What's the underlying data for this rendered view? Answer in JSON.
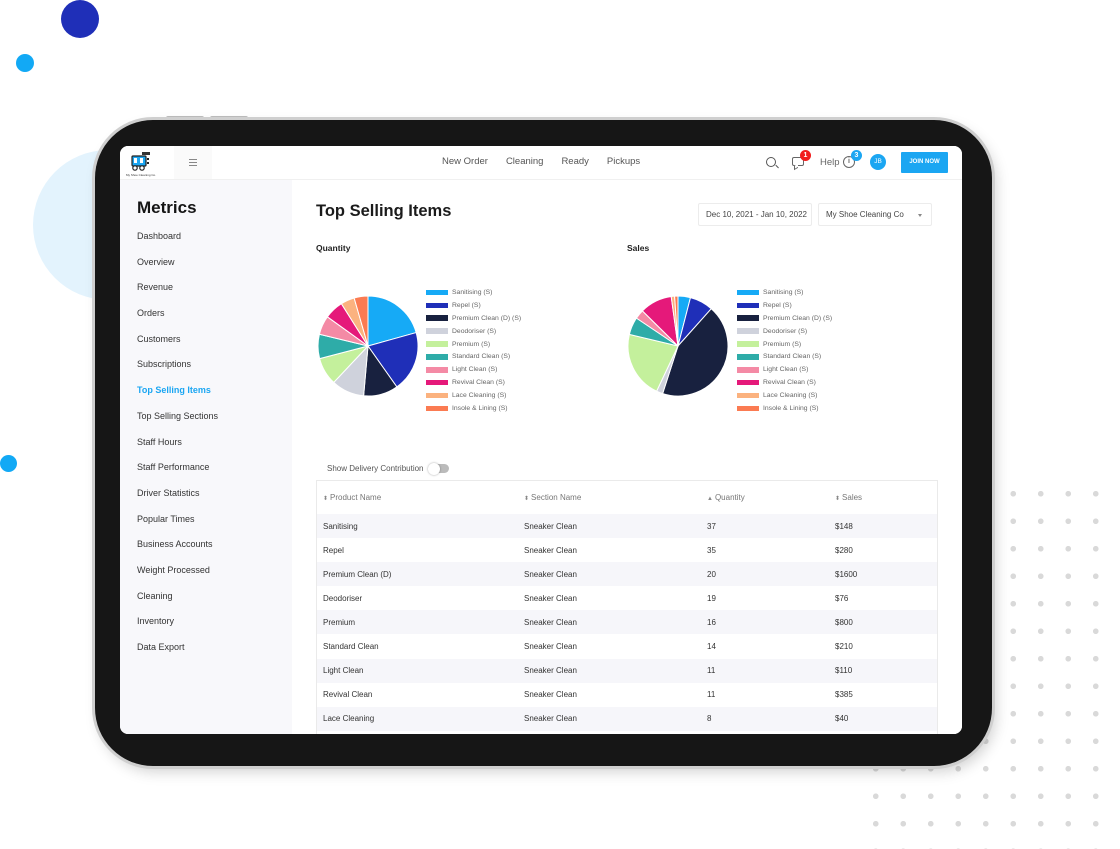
{
  "header": {
    "logo_caption": "My Shoe Cleaning Co.",
    "nav": [
      "New Order",
      "Cleaning",
      "Ready",
      "Pickups"
    ],
    "messages_badge": "1",
    "help_label": "Help",
    "help_badge": "3",
    "info_glyph": "i",
    "avatar_initials": "JB",
    "join_button": "JOIN NOW"
  },
  "sidebar": {
    "title": "Metrics",
    "items": [
      {
        "label": "Dashboard",
        "active": false
      },
      {
        "label": "Overview",
        "active": false
      },
      {
        "label": "Revenue",
        "active": false
      },
      {
        "label": "Orders",
        "active": false
      },
      {
        "label": "Customers",
        "active": false
      },
      {
        "label": "Subscriptions",
        "active": false
      },
      {
        "label": "Top Selling Items",
        "active": true
      },
      {
        "label": "Top Selling Sections",
        "active": false
      },
      {
        "label": "Staff Hours",
        "active": false
      },
      {
        "label": "Staff Performance",
        "active": false
      },
      {
        "label": "Driver Statistics",
        "active": false
      },
      {
        "label": "Popular Times",
        "active": false
      },
      {
        "label": "Business Accounts",
        "active": false
      },
      {
        "label": "Weight Processed",
        "active": false
      },
      {
        "label": "Cleaning",
        "active": false
      },
      {
        "label": "Inventory",
        "active": false
      },
      {
        "label": "Data Export",
        "active": false
      }
    ]
  },
  "main": {
    "title": "Top Selling Items",
    "date_range": "Dec 10, 2021 - Jan 10, 2022",
    "company": "My Shoe Cleaning Co",
    "delivery_toggle_label": "Show Delivery Contribution",
    "delivery_toggle_on": false
  },
  "colors": {
    "accent": "#1ba6f2",
    "badge_red": "#f11c1c"
  },
  "chart_data": [
    {
      "type": "pie",
      "title": "Quantity",
      "legend_position": "right",
      "labels": [
        "Sanitising (S)",
        "Repel (S)",
        "Premium Clean (D) (S)",
        "Deodoriser (S)",
        "Premium (S)",
        "Standard Clean (S)",
        "Light Clean (S)",
        "Revival Clean (S)",
        "Lace Cleaning (S)",
        "Insole & Lining (S)"
      ],
      "colors": [
        "#16aaf6",
        "#1f2fb8",
        "#18213f",
        "#cfd2dc",
        "#c4f09c",
        "#2eaca8",
        "#f48aa5",
        "#e5197a",
        "#fbb27f",
        "#fb7b52"
      ],
      "values": [
        37,
        35,
        20,
        19,
        16,
        14,
        11,
        11,
        8,
        8
      ]
    },
    {
      "type": "pie",
      "title": "Sales",
      "legend_position": "right",
      "labels": [
        "Sanitising (S)",
        "Repel (S)",
        "Premium Clean (D) (S)",
        "Deodoriser (S)",
        "Premium (S)",
        "Standard Clean (S)",
        "Light Clean (S)",
        "Revival Clean (S)",
        "Lace Cleaning (S)",
        "Insole & Lining (S)"
      ],
      "colors": [
        "#16aaf6",
        "#1f2fb8",
        "#18213f",
        "#cfd2dc",
        "#c4f09c",
        "#2eaca8",
        "#f48aa5",
        "#e5197a",
        "#fbb27f",
        "#fb7b52"
      ],
      "values": [
        148,
        280,
        1600,
        76,
        800,
        210,
        110,
        385,
        40,
        40
      ]
    }
  ],
  "table": {
    "columns": [
      {
        "label": "Product Name",
        "sort": "both"
      },
      {
        "label": "Section Name",
        "sort": "both"
      },
      {
        "label": "Quantity",
        "sort": "up"
      },
      {
        "label": "Sales",
        "sort": "both"
      }
    ],
    "rows": [
      [
        "Sanitising",
        "Sneaker Clean",
        "37",
        "$148"
      ],
      [
        "Repel",
        "Sneaker Clean",
        "35",
        "$280"
      ],
      [
        "Premium Clean (D)",
        "Sneaker Clean",
        "20",
        "$1600"
      ],
      [
        "Deodoriser",
        "Sneaker Clean",
        "19",
        "$76"
      ],
      [
        "Premium",
        "Sneaker Clean",
        "16",
        "$800"
      ],
      [
        "Standard Clean",
        "Sneaker Clean",
        "14",
        "$210"
      ],
      [
        "Light Clean",
        "Sneaker Clean",
        "11",
        "$110"
      ],
      [
        "Revival Clean",
        "Sneaker Clean",
        "11",
        "$385"
      ],
      [
        "Lace Cleaning",
        "Sneaker Clean",
        "8",
        "$40"
      ]
    ]
  }
}
